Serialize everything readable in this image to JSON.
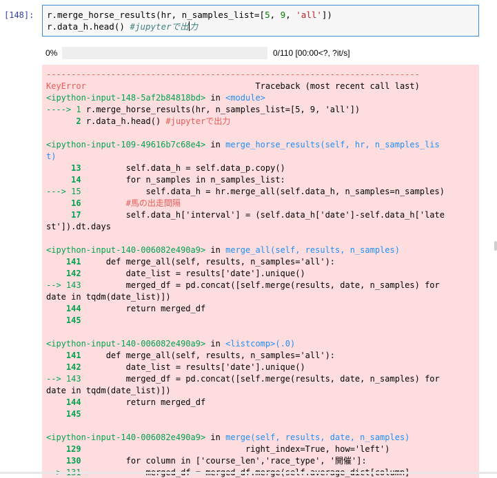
{
  "cell": {
    "prompt": "[148]:",
    "code_line1_a": "r.merge_horse_results(hr, n_samples_list=[",
    "code_line1_n1": "5",
    "code_line1_sep": ", ",
    "code_line1_n2": "9",
    "code_line1_s": "'all'",
    "code_line1_end": "])",
    "code_line2_a": "r.data_h.head() ",
    "code_line2_cmt_a": "#jupyterで出",
    "code_line2_cmt_b": "力"
  },
  "progress": {
    "percent_label": "0%",
    "fraction": 0,
    "stats": "0/110 [00:00<?, ?it/s]"
  },
  "traceback": {
    "separator": "---------------------------------------------------------------------------",
    "error_name": "KeyError",
    "header_right": "                                  Traceback (most recent call last)",
    "f1_loc": "<ipython-input-148-5af2b84818bd>",
    "f1_in": " in ",
    "f1_func": "<module>",
    "f1_l1_arrow": "----> 1 ",
    "f1_l1_code": "r.merge_horse_results(hr, n_samples_list=[5, 9, 'all'])",
    "f1_l2_num": "      2 ",
    "f1_l2_code": "r.data_h.head() ",
    "f1_l2_cmt": "#jupyterで出力",
    "f2_loc": "<ipython-input-109-49616b7c68e4>",
    "f2_in": " in ",
    "f2_func": "merge_horse_results(self, hr, n_samples_lis",
    "f2_func2": "t)",
    "f2_l13": "     13 ",
    "f2_c13": "        self.data_h = self.data_p.copy()",
    "f2_l14": "     14 ",
    "f2_c14": "        for n_samples in n_samples_list:",
    "f2_l15": "---> 15 ",
    "f2_c15": "            self.data_h = hr.merge_all(self.data_h, n_samples=n_samples)",
    "f2_l16": "     16 ",
    "f2_c16": "        #馬の出走間隔",
    "f2_l17": "     17 ",
    "f2_c17": "        self.data_h['interval'] = (self.data_h['date']-self.data_h['late",
    "f2_c17b": "st']).dt.days",
    "f3_loc": "<ipython-input-140-006082e490a9>",
    "f3_in": " in ",
    "f3_func": "merge_all(self, results, n_samples)",
    "f3_l141": "    141 ",
    "f3_c141": "    def merge_all(self, results, n_samples='all'):",
    "f3_l142": "    142 ",
    "f3_c142": "        date_list = results['date'].unique()",
    "f3_l143": "--> 143 ",
    "f3_c143": "        merged_df = pd.concat([self.merge(results, date, n_samples) for",
    "f3_c143b": "date in tqdm(date_list)])",
    "f3_l144": "    144 ",
    "f3_c144": "        return merged_df",
    "f3_l145": "    145 ",
    "f4_loc": "<ipython-input-140-006082e490a9>",
    "f4_in": " in ",
    "f4_func": "<listcomp>(.0)",
    "f4_l141": "    141 ",
    "f4_c141": "    def merge_all(self, results, n_samples='all'):",
    "f4_l142": "    142 ",
    "f4_c142": "        date_list = results['date'].unique()",
    "f4_l143": "--> 143 ",
    "f4_c143": "        merged_df = pd.concat([self.merge(results, date, n_samples) for",
    "f4_c143b": "date in tqdm(date_list)])",
    "f4_l144": "    144 ",
    "f4_c144": "        return merged_df",
    "f4_l145": "    145 ",
    "f5_loc": "<ipython-input-140-006082e490a9>",
    "f5_in": " in ",
    "f5_func": "merge(self, results, date, n_samples)",
    "f5_l129": "    129 ",
    "f5_c129": "                                right_index=True, how='left')",
    "f5_l130": "    130 ",
    "f5_c130": "        for column in ['course_len','race_type', '開催']:",
    "f5_l131": "--> 131 ",
    "f5_c131": "            merged_df = merged_df.merge(self.average_dict[column]"
  }
}
